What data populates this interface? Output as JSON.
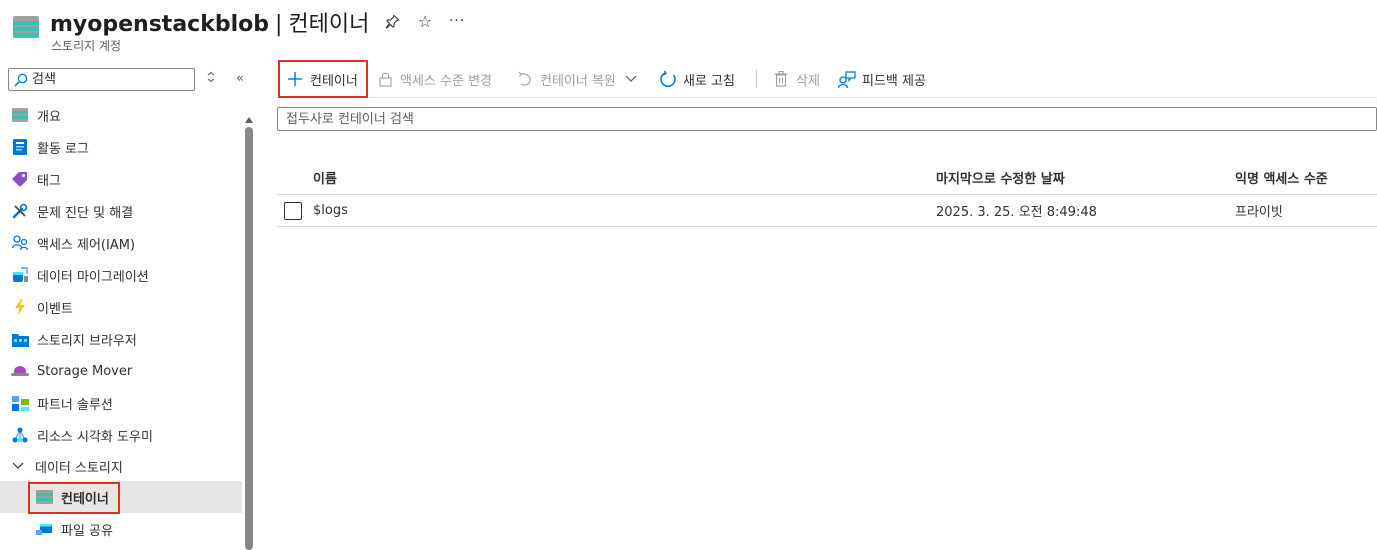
{
  "header": {
    "resource_name": "myopenstackblob",
    "separator": "|",
    "page_title": "컨테이너",
    "subtitle": "스토리지 계정",
    "more_label": "···"
  },
  "sidebar": {
    "search_placeholder": "검색",
    "collapse_glyph": "«",
    "items": [
      {
        "label": "개요",
        "icon": "storage-overview-icon"
      },
      {
        "label": "활동 로그",
        "icon": "activity-log-icon"
      },
      {
        "label": "태그",
        "icon": "tag-icon"
      },
      {
        "label": "문제 진단 및 해결",
        "icon": "wrench-icon"
      },
      {
        "label": "액세스 제어(IAM)",
        "icon": "people-icon"
      },
      {
        "label": "데이터 마이그레이션",
        "icon": "migration-icon"
      },
      {
        "label": "이벤트",
        "icon": "lightning-icon"
      },
      {
        "label": "스토리지 브라우저",
        "icon": "storage-browser-icon"
      },
      {
        "label": "Storage Mover",
        "icon": "storage-mover-icon"
      },
      {
        "label": "파트너 솔루션",
        "icon": "partner-icon"
      },
      {
        "label": "리소스 시각화 도우미",
        "icon": "resource-visualizer-icon"
      }
    ],
    "group": {
      "label": "데이터 스토리지",
      "expanded": true
    },
    "children": [
      {
        "label": "컨테이너",
        "icon": "container-icon",
        "selected": true
      },
      {
        "label": "파일 공유",
        "icon": "file-share-icon",
        "selected": false
      }
    ]
  },
  "toolbar": {
    "add_container": "컨테이너",
    "change_access_level": "액세스 수준 변경",
    "restore_container": "컨테이너 복원",
    "refresh": "새로 고침",
    "delete": "삭제",
    "feedback": "피드백 제공"
  },
  "filter": {
    "placeholder": "접두사로 컨테이너 검색"
  },
  "table": {
    "columns": [
      "이름",
      "마지막으로 수정한 날짜",
      "익명 액세스 수준"
    ],
    "rows": [
      {
        "name": "$logs",
        "last_modified": "2025. 3. 25. 오전 8:49:48",
        "access_level": "프라이빗"
      }
    ]
  },
  "colors": {
    "accent": "#0078d4",
    "highlight_border": "#e0301e",
    "selected_bg": "#e8e6e4",
    "disabled_text": "#a19f9d"
  }
}
